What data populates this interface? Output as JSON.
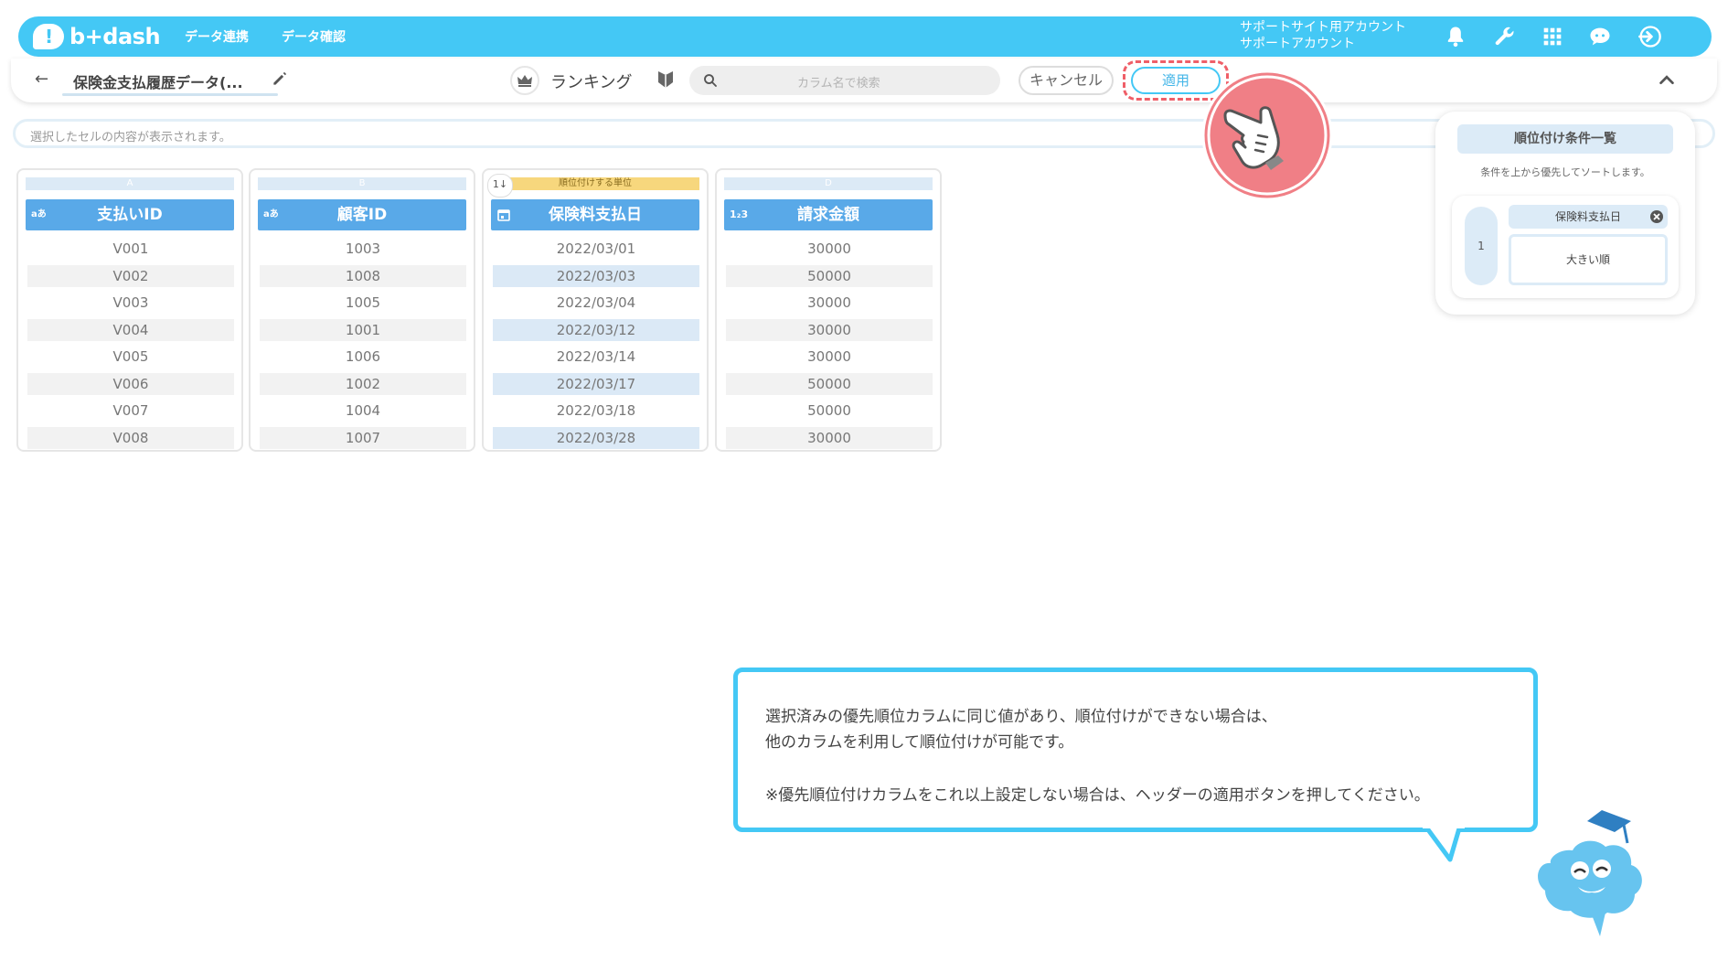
{
  "header": {
    "logo_text": "b+dash",
    "nav": [
      "データ連携",
      "データ確認"
    ],
    "account_line1": "サポートサイト用アカウント",
    "account_line2": "サポートアカウント",
    "icons": [
      "bell-icon",
      "wrench-icon",
      "apps-grid-icon",
      "chat-icon",
      "logout-icon"
    ]
  },
  "toolbar": {
    "back_label": "←",
    "dataset_title": "保険金支払履歴データ(...",
    "mode_label": "ランキング",
    "search_placeholder": "カラム名で検索",
    "cancel_label": "キャンセル",
    "apply_label": "適用"
  },
  "cell_preview": {
    "placeholder": "選択したセルの内容が表示されます。"
  },
  "table": {
    "columns": [
      {
        "letter": "A",
        "type": "aあ",
        "name": "支払いID",
        "values": [
          "V001",
          "V002",
          "V003",
          "V004",
          "V005",
          "V006",
          "V007",
          "V008"
        ]
      },
      {
        "letter": "B",
        "type": "aあ",
        "name": "顧客ID",
        "values": [
          "1003",
          "1008",
          "1005",
          "1001",
          "1006",
          "1002",
          "1004",
          "1007"
        ]
      },
      {
        "letter": "順位付けする単位",
        "type": "calendar",
        "badge": "1↓",
        "name": "保険料支払日",
        "values": [
          "2022/03/01",
          "2022/03/03",
          "2022/03/04",
          "2022/03/12",
          "2022/03/14",
          "2022/03/17",
          "2022/03/18",
          "2022/03/28"
        ]
      },
      {
        "letter": "D",
        "type": "1₂3",
        "name": "請求金額",
        "values": [
          "30000",
          "50000",
          "30000",
          "30000",
          "30000",
          "50000",
          "50000",
          "30000"
        ]
      }
    ]
  },
  "ranking_panel": {
    "title": "順位付け条件一覧",
    "description": "条件を上から優先してソートします。",
    "conditions": [
      {
        "index": "1",
        "column": "保険料支払日",
        "order": "大きい順"
      }
    ]
  },
  "guide_bubble": {
    "line1": "選択済みの優先順位カラムに同じ値があり、順位付けができない場合は、",
    "line2": "他のカラムを利用して順位付けが可能です。",
    "line3": "※優先順位付けカラムをこれ以上設定しない場合は、ヘッダーの適用ボタンを押してください。"
  },
  "colors": {
    "brand": "#44c8f5",
    "column_header": "#59a9e8",
    "highlight": "#ef5f68",
    "rank_unit": "#f7d77d"
  }
}
